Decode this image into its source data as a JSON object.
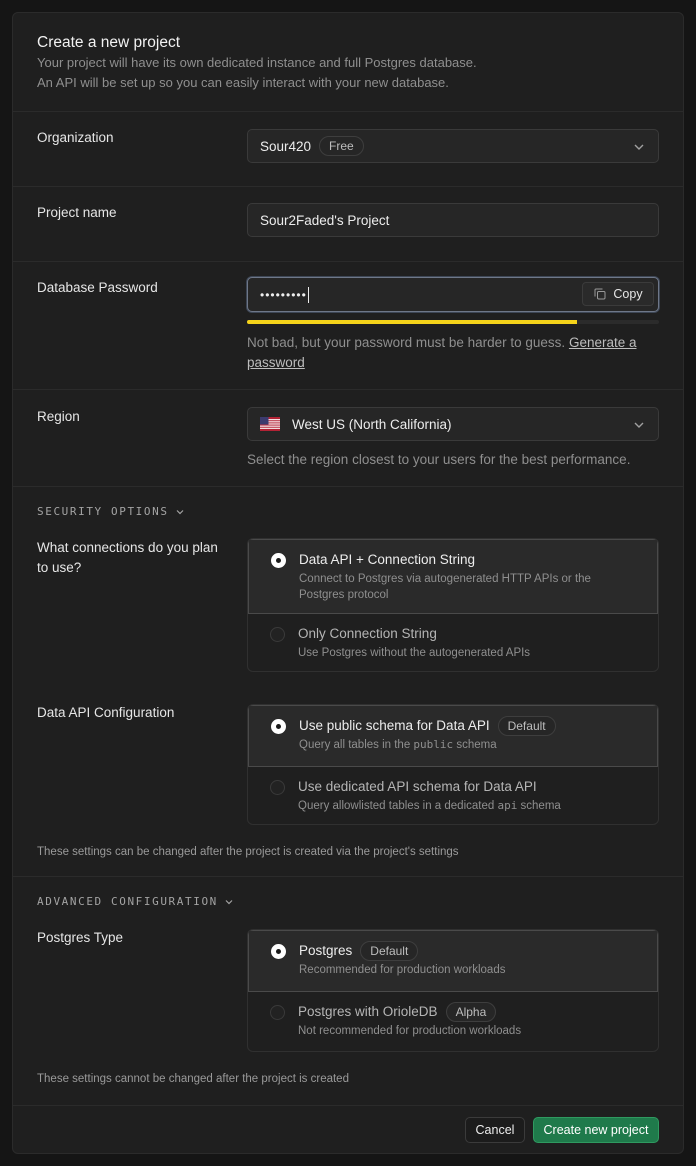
{
  "header": {
    "title": "Create a new project",
    "desc_line1": "Your project will have its own dedicated instance and full Postgres database.",
    "desc_line2": "An API will be set up so you can easily interact with your new database."
  },
  "organization": {
    "label": "Organization",
    "value": "Sour420",
    "badge": "Free",
    "icon": "chevron-down-icon"
  },
  "project_name": {
    "label": "Project name",
    "value": "Sour2Faded's Project"
  },
  "password": {
    "label": "Database Password",
    "value": "•••••••••",
    "copy_label": "Copy",
    "strength_fraction": 0.8,
    "strength_color": "#f5d31a",
    "help": "Not bad, but your password must be harder to guess. ",
    "help_link_1": "Generate a",
    "help_link_2": "password"
  },
  "region": {
    "label": "Region",
    "value": "West US (North California)",
    "flag": "us-flag-icon",
    "help": "Select the region closest to your users for the best performance."
  },
  "security": {
    "section_title": "SECURITY OPTIONS",
    "connections": {
      "label_line1": "What connections do you plan",
      "label_line2": "to use?",
      "options": [
        {
          "title": "Data API + Connection String",
          "desc_line1": "Connect to Postgres via autogenerated HTTP APIs or the",
          "desc_line2": "Postgres protocol",
          "selected": true
        },
        {
          "title": "Only Connection String",
          "desc": "Use Postgres without the autogenerated APIs",
          "selected": false
        }
      ]
    },
    "data_api": {
      "label": "Data API Configuration",
      "options": [
        {
          "title": "Use public schema for Data API",
          "badge": "Default",
          "desc_pre": "Query all tables in the ",
          "desc_code": "public",
          "desc_post": " schema",
          "selected": true
        },
        {
          "title": "Use dedicated API schema for Data API",
          "desc_pre": "Query allowlisted tables in a dedicated ",
          "desc_code": "api",
          "desc_post": " schema",
          "selected": false
        }
      ]
    },
    "note": "These settings can be changed after the project is created via the project's settings"
  },
  "advanced": {
    "section_title": "ADVANCED CONFIGURATION",
    "postgres_type": {
      "label": "Postgres Type",
      "options": [
        {
          "title": "Postgres",
          "badge": "Default",
          "desc": "Recommended for production workloads",
          "selected": true
        },
        {
          "title": "Postgres with OrioleDB",
          "badge": "Alpha",
          "desc": "Not recommended for production workloads",
          "selected": false
        }
      ]
    },
    "note": "These settings cannot be changed after the project is created"
  },
  "footer": {
    "cancel_label": "Cancel",
    "create_label": "Create new project",
    "accent": "#1f7a4b"
  }
}
